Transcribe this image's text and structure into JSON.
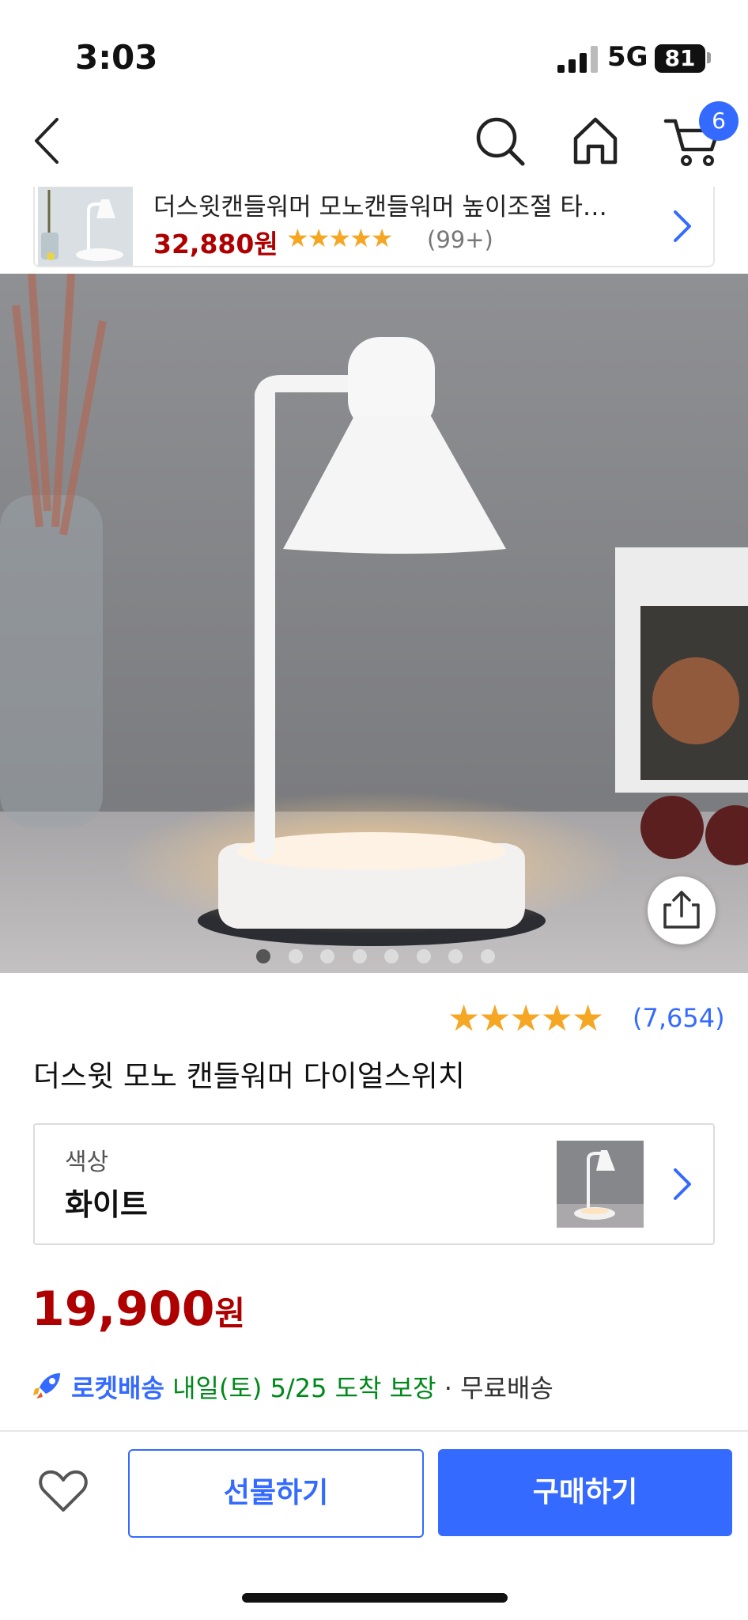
{
  "status_bar": {
    "time": "3:03",
    "network": "5G",
    "battery": "81"
  },
  "nav": {
    "cart_count": "6",
    "icons": [
      "back-icon",
      "search-icon",
      "home-icon",
      "cart-icon"
    ]
  },
  "related_product": {
    "title": "더스윗캔들워머 모노캔들워머 높이조절 타…",
    "price": "32,880원",
    "stars": "★★★★★",
    "rating": 4.5,
    "review_count": "(99+)"
  },
  "gallery": {
    "total_images": 8,
    "current_index": 1
  },
  "product": {
    "stars": "★★★★★",
    "rating": 5,
    "review_count": "(7,654)",
    "name": "더스윗 모노 캔들워머 다이얼스위치",
    "option_label": "색상",
    "option_value": "화이트",
    "price": "19,900",
    "price_unit": "원",
    "delivery": {
      "badge": "로켓배송",
      "date": "내일(토) 5/25 도착 보장",
      "separator": " · ",
      "shipping": "무료배송"
    }
  },
  "actions": {
    "gift_label": "선물하기",
    "buy_label": "구매하기"
  },
  "colors": {
    "accent": "#346aff",
    "price_red": "#ae0000",
    "delivery_green": "#00891a",
    "star": "#f5a623"
  }
}
